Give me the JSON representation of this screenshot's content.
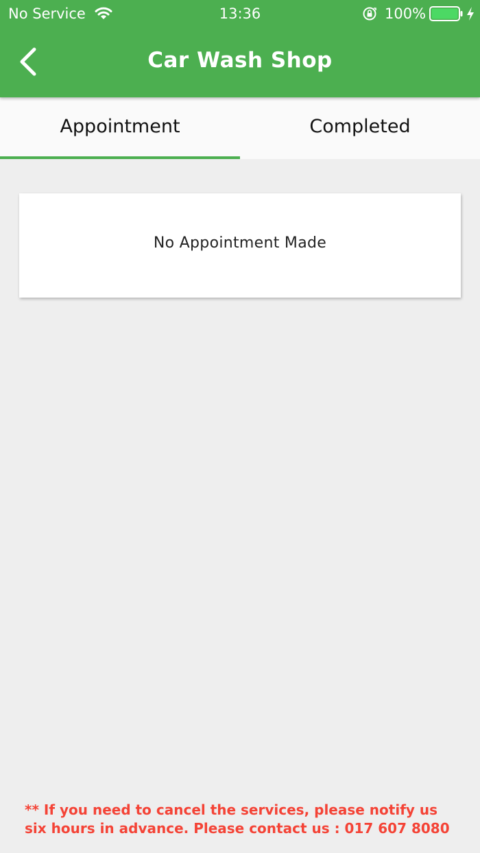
{
  "status_bar": {
    "carrier": "No Service",
    "time": "13:36",
    "battery_percent": "100%",
    "battery_level": 1.0,
    "icons": [
      "wifi-icon",
      "orientation-lock-icon",
      "battery-icon",
      "charging-bolt-icon"
    ]
  },
  "nav": {
    "title": "Car Wash Shop",
    "back_icon": "chevron-left-icon"
  },
  "tabs": [
    {
      "label": "Appointment",
      "active": true
    },
    {
      "label": "Completed",
      "active": false
    }
  ],
  "appointments": {
    "empty_message": "No Appointment Made"
  },
  "notice": {
    "text": "** If you need to cancel the services, please notify us six hours in advance. Please contact us : 017 607 8080"
  },
  "colors": {
    "primary": "#4caf50",
    "background": "#eeeeee",
    "notice_text": "#f44336"
  }
}
